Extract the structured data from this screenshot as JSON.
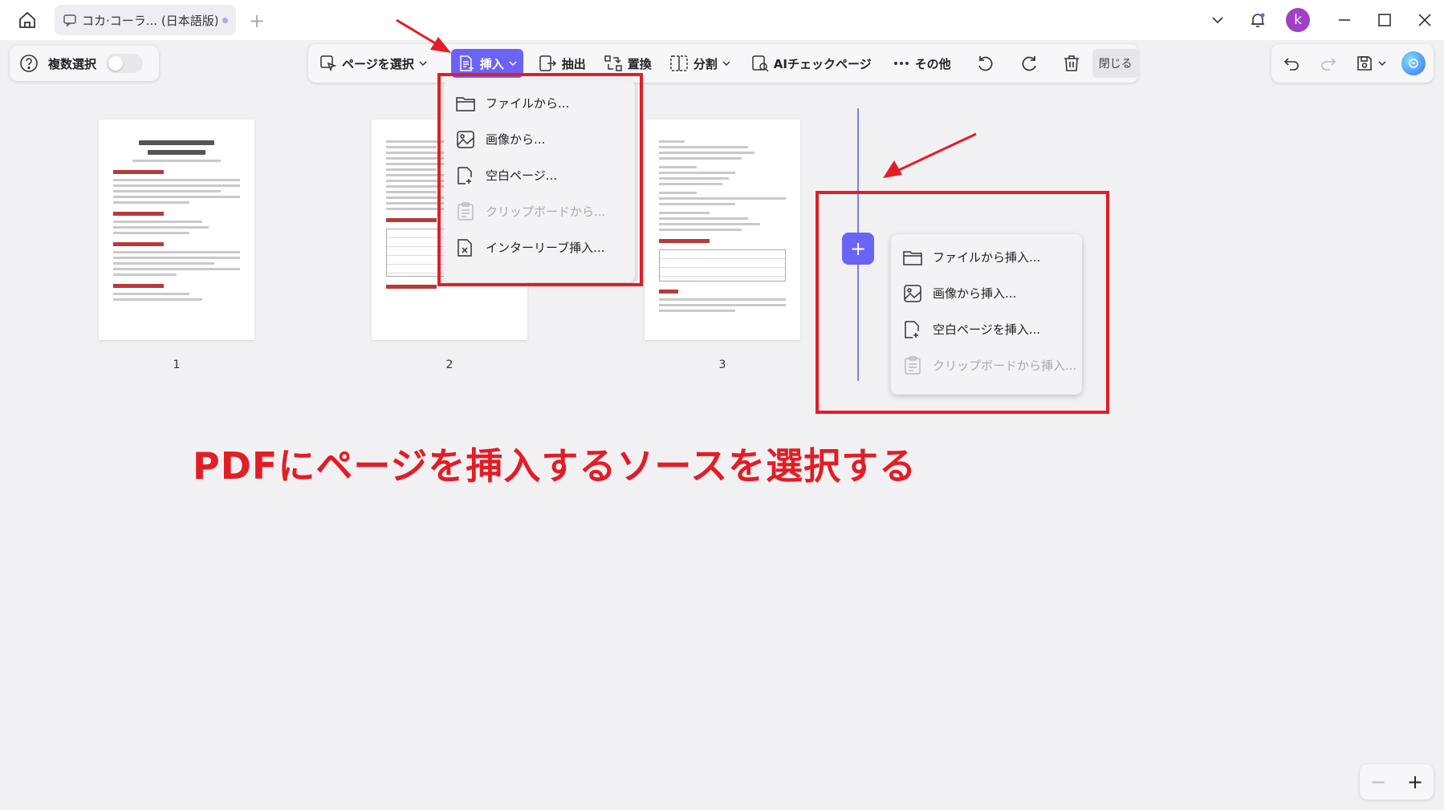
{
  "titlebar": {
    "tab_title": "コカ·コーラ... (日本語版)",
    "new_tab": "+",
    "avatar_letter": "k"
  },
  "toolbar": {
    "multi_select_label": "複数選択",
    "select_page": "ページを選択",
    "insert": "挿入",
    "extract": "抽出",
    "replace": "置換",
    "split": "分割",
    "ai_check": "AIチェックページ",
    "more": "その他",
    "close": "閉じる"
  },
  "pages": [
    {
      "number": "1"
    },
    {
      "number": "2"
    },
    {
      "number": "3"
    }
  ],
  "insert_menu": {
    "items": [
      {
        "label": "ファイルから...",
        "icon": "folder-icon",
        "enabled": true
      },
      {
        "label": "画像から...",
        "icon": "image-icon",
        "enabled": true
      },
      {
        "label": "空白ページ...",
        "icon": "blank-page-icon",
        "enabled": true
      },
      {
        "label": "クリップボードから...",
        "icon": "clipboard-icon",
        "enabled": false
      },
      {
        "label": "インターリーブ挿入...",
        "icon": "interleave-icon",
        "enabled": true
      }
    ]
  },
  "side_menu": {
    "plus": "+",
    "items": [
      {
        "label": "ファイルから挿入...",
        "icon": "folder-icon",
        "enabled": true
      },
      {
        "label": "画像から挿入...",
        "icon": "image-icon",
        "enabled": true
      },
      {
        "label": "空白ページを挿入...",
        "icon": "blank-page-icon",
        "enabled": true
      },
      {
        "label": "クリップボードから挿入...",
        "icon": "clipboard-icon",
        "enabled": false
      }
    ]
  },
  "annotation": {
    "caption": "PDFにページを挿入するソースを選択する",
    "color": "#e21d25"
  },
  "zoom": {
    "minus": "−",
    "plus": "+"
  },
  "colors": {
    "accent": "#6b63f6",
    "background": "#f1f1f3"
  }
}
